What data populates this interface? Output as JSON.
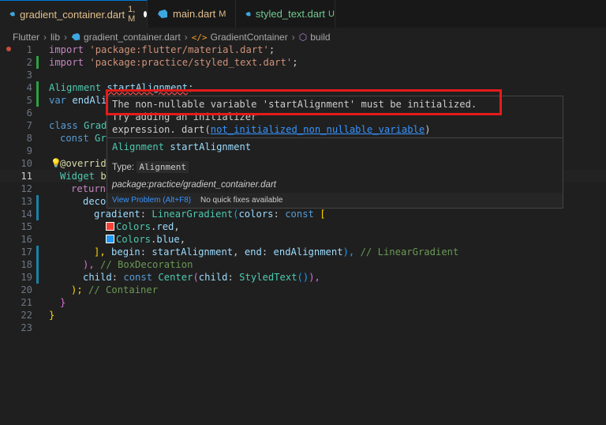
{
  "tabs": [
    {
      "name": "gradient_container.dart",
      "badge": "1, M",
      "active": true,
      "dirty": true
    },
    {
      "name": "main.dart",
      "badge": "M",
      "active": false,
      "dirty": false
    },
    {
      "name": "styled_text.dart",
      "badge": "U",
      "active": false,
      "dirty": false
    }
  ],
  "breadcrumb": [
    "Flutter",
    "lib",
    "gradient_container.dart",
    "GradientContainer",
    "build"
  ],
  "line_numbers": [
    "1",
    "2",
    "3",
    "4",
    "5",
    "6",
    "7",
    "8",
    "9",
    "10",
    "11",
    "12",
    "13",
    "14",
    "15",
    "16",
    "17",
    "18",
    "19",
    "20",
    "21",
    "22",
    "23"
  ],
  "code": {
    "l1_a": "import ",
    "l1_b": "'package:flutter/material.dart'",
    "l1_c": ";",
    "l2_a": "import ",
    "l2_b": "'package:practice/styled_text.dart'",
    "l2_c": ";",
    "l4_a": "Alignment ",
    "l4_b": "startAlignment",
    "l4_c": ";",
    "l5_a": "var ",
    "l5_b": "endAli",
    "l7_a": "class ",
    "l7_b": "Grad",
    "l8_a": "const ",
    "l8_b": "Gr",
    "l10_a": "@overrid",
    "l11_a": "Widget ",
    "l11_b": "b",
    "l12_a": "return",
    "l13_a": "deco",
    "l14_a": "gradient",
    "l14_b": ": ",
    "l14_c": "LinearGradient",
    "l14_d": "(",
    "l14_e": "colors",
    "l14_f": ": ",
    "l14_g": "const ",
    "l14_h": "[",
    "l15_a": "Colors",
    "l15_b": ".",
    "l15_c": "red",
    "l15_d": ",",
    "l16_a": "Colors",
    "l16_b": ".",
    "l16_c": "blue",
    "l16_d": ",",
    "l17_a": "], ",
    "l17_b": "begin",
    "l17_c": ": ",
    "l17_d": "startAlignment",
    "l17_e": ", ",
    "l17_f": "end",
    "l17_g": ": ",
    "l17_h": "endAlignment",
    "l17_i": "), ",
    "l17_j": "// LinearGradient",
    "l18_a": "), ",
    "l18_b": "// BoxDecoration",
    "l19_a": "child",
    "l19_b": ": ",
    "l19_c": "const ",
    "l19_d": "Center",
    "l19_e": "(",
    "l19_f": "child",
    "l19_g": ": ",
    "l19_h": "StyledText",
    "l19_i": "()",
    "l19_j": "),",
    "l20_a": "); ",
    "l20_b": "// Container",
    "l21_a": "}",
    "l22_a": "}"
  },
  "hover": {
    "message_line1": "The non-nullable variable 'startAlignment' must be initialized.",
    "message_line2": "Try adding an initializer",
    "message_line3a": "expression. dart(",
    "message_code": "not_initialized_non_nullable_variable",
    "message_line3b": ")",
    "decl_type": "Alignment",
    "decl_name": "startAlignment",
    "type_label": "Type:",
    "type_value": "Alignment",
    "package": "package:practice/gradient_container.dart",
    "view_problem": "View Problem (Alt+F8)",
    "no_fixes": "No quick fixes available"
  },
  "colors": {
    "red_swatch": "#f44336",
    "blue_swatch": "#2196f3",
    "highlight": "#e41b1b"
  }
}
